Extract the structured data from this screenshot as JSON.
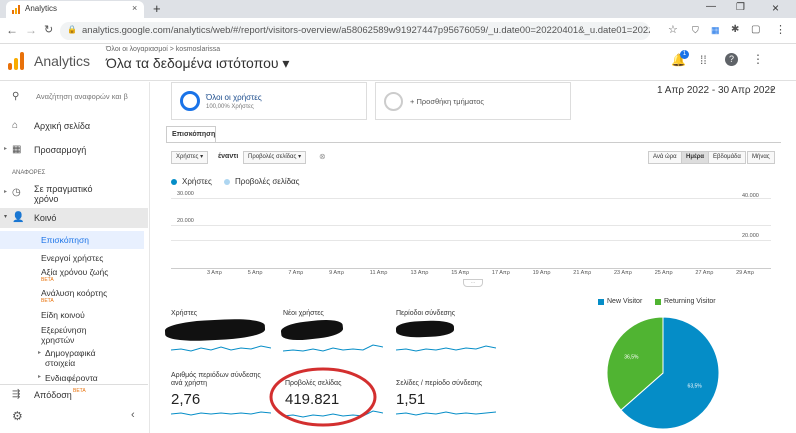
{
  "browser": {
    "tab_title": "Analytics",
    "url": "analytics.google.com/analytics/web/#/report/visitors-overview/a58062589w91927447p95676059/_u.date00=20220401&_u.date01=20220430&overview..."
  },
  "header": {
    "product": "Analytics",
    "breadcrumb": "Όλοι οι λογαριασμοί > kosmoslarissa",
    "view_title": "Όλα τα δεδομένα ιστότοπου ▾",
    "notification_count": "1"
  },
  "sidebar": {
    "search_placeholder": "Αναζήτηση αναφορών και β",
    "home": "Αρχική σελίδα",
    "customize": "Προσαρμογή",
    "reports_section": "ΑΝΑΦΟΡΕΣ",
    "realtime_1": "Σε πραγματικό",
    "realtime_2": "χρόνο",
    "audience": "Κοινό",
    "sub_overview": "Επισκόπηση",
    "sub_active": "Ενεργοί χρήστες",
    "sub_lifetime": "Αξία χρόνου ζωής",
    "sub_cohort": "Ανάλυση κοόρτης",
    "sub_types": "Είδη κοινού",
    "sub_explorer_1": "Εξερεύνηση",
    "sub_explorer_2": "χρηστών",
    "sub_demo_1": "Δημογραφικά",
    "sub_demo_2": "στοιχεία",
    "sub_interests": "Ενδιαφέροντα",
    "acquisition": "Απόδοση",
    "beta": "BETA"
  },
  "segments": {
    "all_users": "Όλοι οι χρήστες",
    "all_users_pct": "100,00% Χρήστες",
    "add_segment": "+ Προσθήκη τμήματος",
    "date_range": "1 Απρ 2022 - 30 Απρ 2022"
  },
  "overview_tab": "Επισκόπηση",
  "controls": {
    "metric1": "Χρήστες",
    "vs": "έναντι",
    "metric2": "Προβολές σελίδας",
    "hour": "Ανά ώρα",
    "day": "Ημέρα",
    "week": "Εβδομάδα",
    "month": "Μήνας"
  },
  "chart_data": {
    "type": "line",
    "series": [
      {
        "name": "Χρήστες",
        "color": "#058dc7"
      },
      {
        "name": "Προβολές σελίδας",
        "color": "#aed6f1"
      }
    ],
    "left_axis_ticks": [
      "30.000",
      "20.000"
    ],
    "right_axis_ticks": [
      "40.000",
      "20.000"
    ],
    "x_ticks": [
      "3 Απρ",
      "5 Απρ",
      "7 Απρ",
      "9 Απρ",
      "11 Απρ",
      "13 Απρ",
      "15 Απρ",
      "17 Απρ",
      "19 Απρ",
      "21 Απρ",
      "23 Απρ",
      "25 Απρ",
      "27 Απρ",
      "29 Απρ"
    ]
  },
  "metrics": {
    "users": "Χρήστες",
    "new_users": "Νέοι χρήστες",
    "sessions": "Περίοδοι σύνδεσης",
    "sessions_per_user_1": "Αριθμός περιόδων σύνδεσης",
    "sessions_per_user_2": "ανά χρήστη",
    "sessions_per_user_val": "2,76",
    "pageviews": "Προβολές σελίδας",
    "pageviews_val": "419.821",
    "pages_per_session": "Σελίδες / περίοδο σύνδεσης",
    "pages_per_session_val": "1,51"
  },
  "pie": {
    "type": "pie",
    "legend": [
      "New Visitor",
      "Returning Visitor"
    ],
    "values": [
      63.5,
      36.5
    ],
    "labels": [
      "63,5%",
      "36,5%"
    ],
    "colors": [
      "#058dc7",
      "#50b432"
    ]
  }
}
